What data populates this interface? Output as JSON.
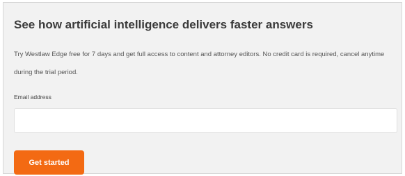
{
  "trial_card": {
    "title": "See how artificial intelligence delivers faster answers",
    "description": "Try Westlaw Edge free for 7 days and get full access to content and attorney editors. No credit card is required, cancel anytime during the trial period.",
    "email": {
      "label": "Email address",
      "value": "",
      "placeholder": ""
    },
    "cta_label": "Get started"
  },
  "colors": {
    "accent": "#f36a13",
    "card_background": "#f2f2f2",
    "title_text": "#3a3a3a"
  }
}
